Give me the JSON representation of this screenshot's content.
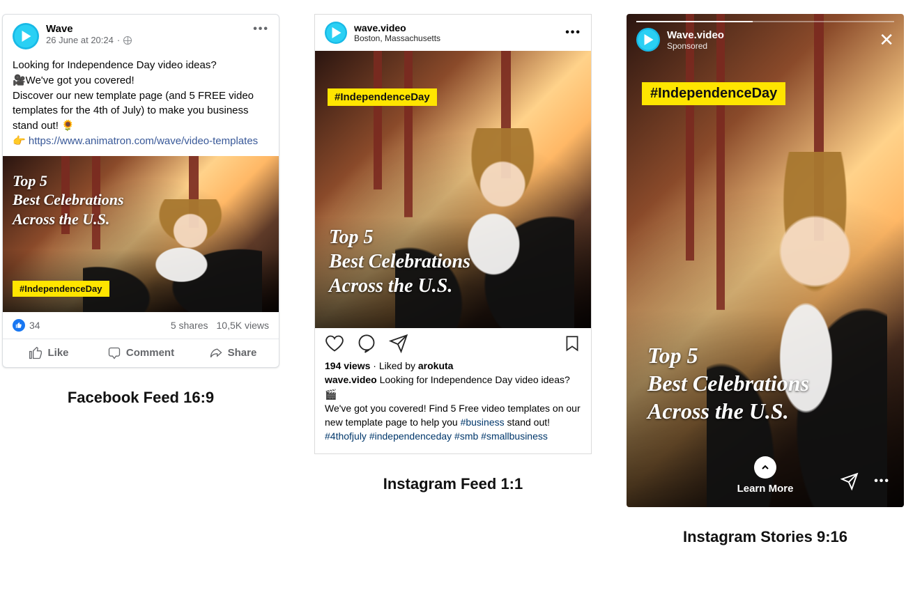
{
  "fb": {
    "name": "Wave",
    "timestamp": "26 June at 20:24",
    "body_line1": "Looking for Independence Day video ideas?",
    "body_line2": "🎥We've got you covered!",
    "body_line3": "Discover our new template page (and 5 FREE video templates for the 4th of July) to make you business stand out! 🌻",
    "body_pointer": "👉 ",
    "body_link": "https://www.animatron.com/wave/video-templates",
    "video_headline_l1": "Top 5",
    "video_headline_l2": "Best Celebrations",
    "video_headline_l3": "Across the U.S.",
    "video_tag": "#IndependenceDay",
    "like_count": "34",
    "shares": "5 shares",
    "views": "10,5K views",
    "act_like": "Like",
    "act_comment": "Comment",
    "act_share": "Share"
  },
  "ig": {
    "name": "wave.video",
    "location": "Boston, Massachusetts",
    "video_tag": "#IndependenceDay",
    "video_headline_l1": "Top 5",
    "video_headline_l2": "Best Celebrations",
    "video_headline_l3": "Across the U.S.",
    "views": "194 views",
    "liked_by_prefix": " · Liked by ",
    "liked_by": "arokuta",
    "caption_user": "wave.video",
    "caption_text": " Looking for Independence Day video ideas?🎬",
    "caption_line2a": "We've got you covered! Find 5 Free video templates on our new template page to help you ",
    "caption_hash_biz": "#business",
    "caption_line2b": " stand out!",
    "hashtags": "#4thofjuly #independenceday #smb #smallbusiness"
  },
  "st": {
    "name": "Wave.video",
    "sponsored": "Sponsored",
    "video_tag": "#IndependenceDay",
    "video_headline_l1": "Top 5",
    "video_headline_l2": "Best Celebrations",
    "video_headline_l3": "Across the U.S.",
    "cta": "Learn More"
  },
  "captions": {
    "fb": "Facebook Feed 16:9",
    "ig": "Instagram Feed 1:1",
    "st": "Instagram Stories 9:16"
  }
}
